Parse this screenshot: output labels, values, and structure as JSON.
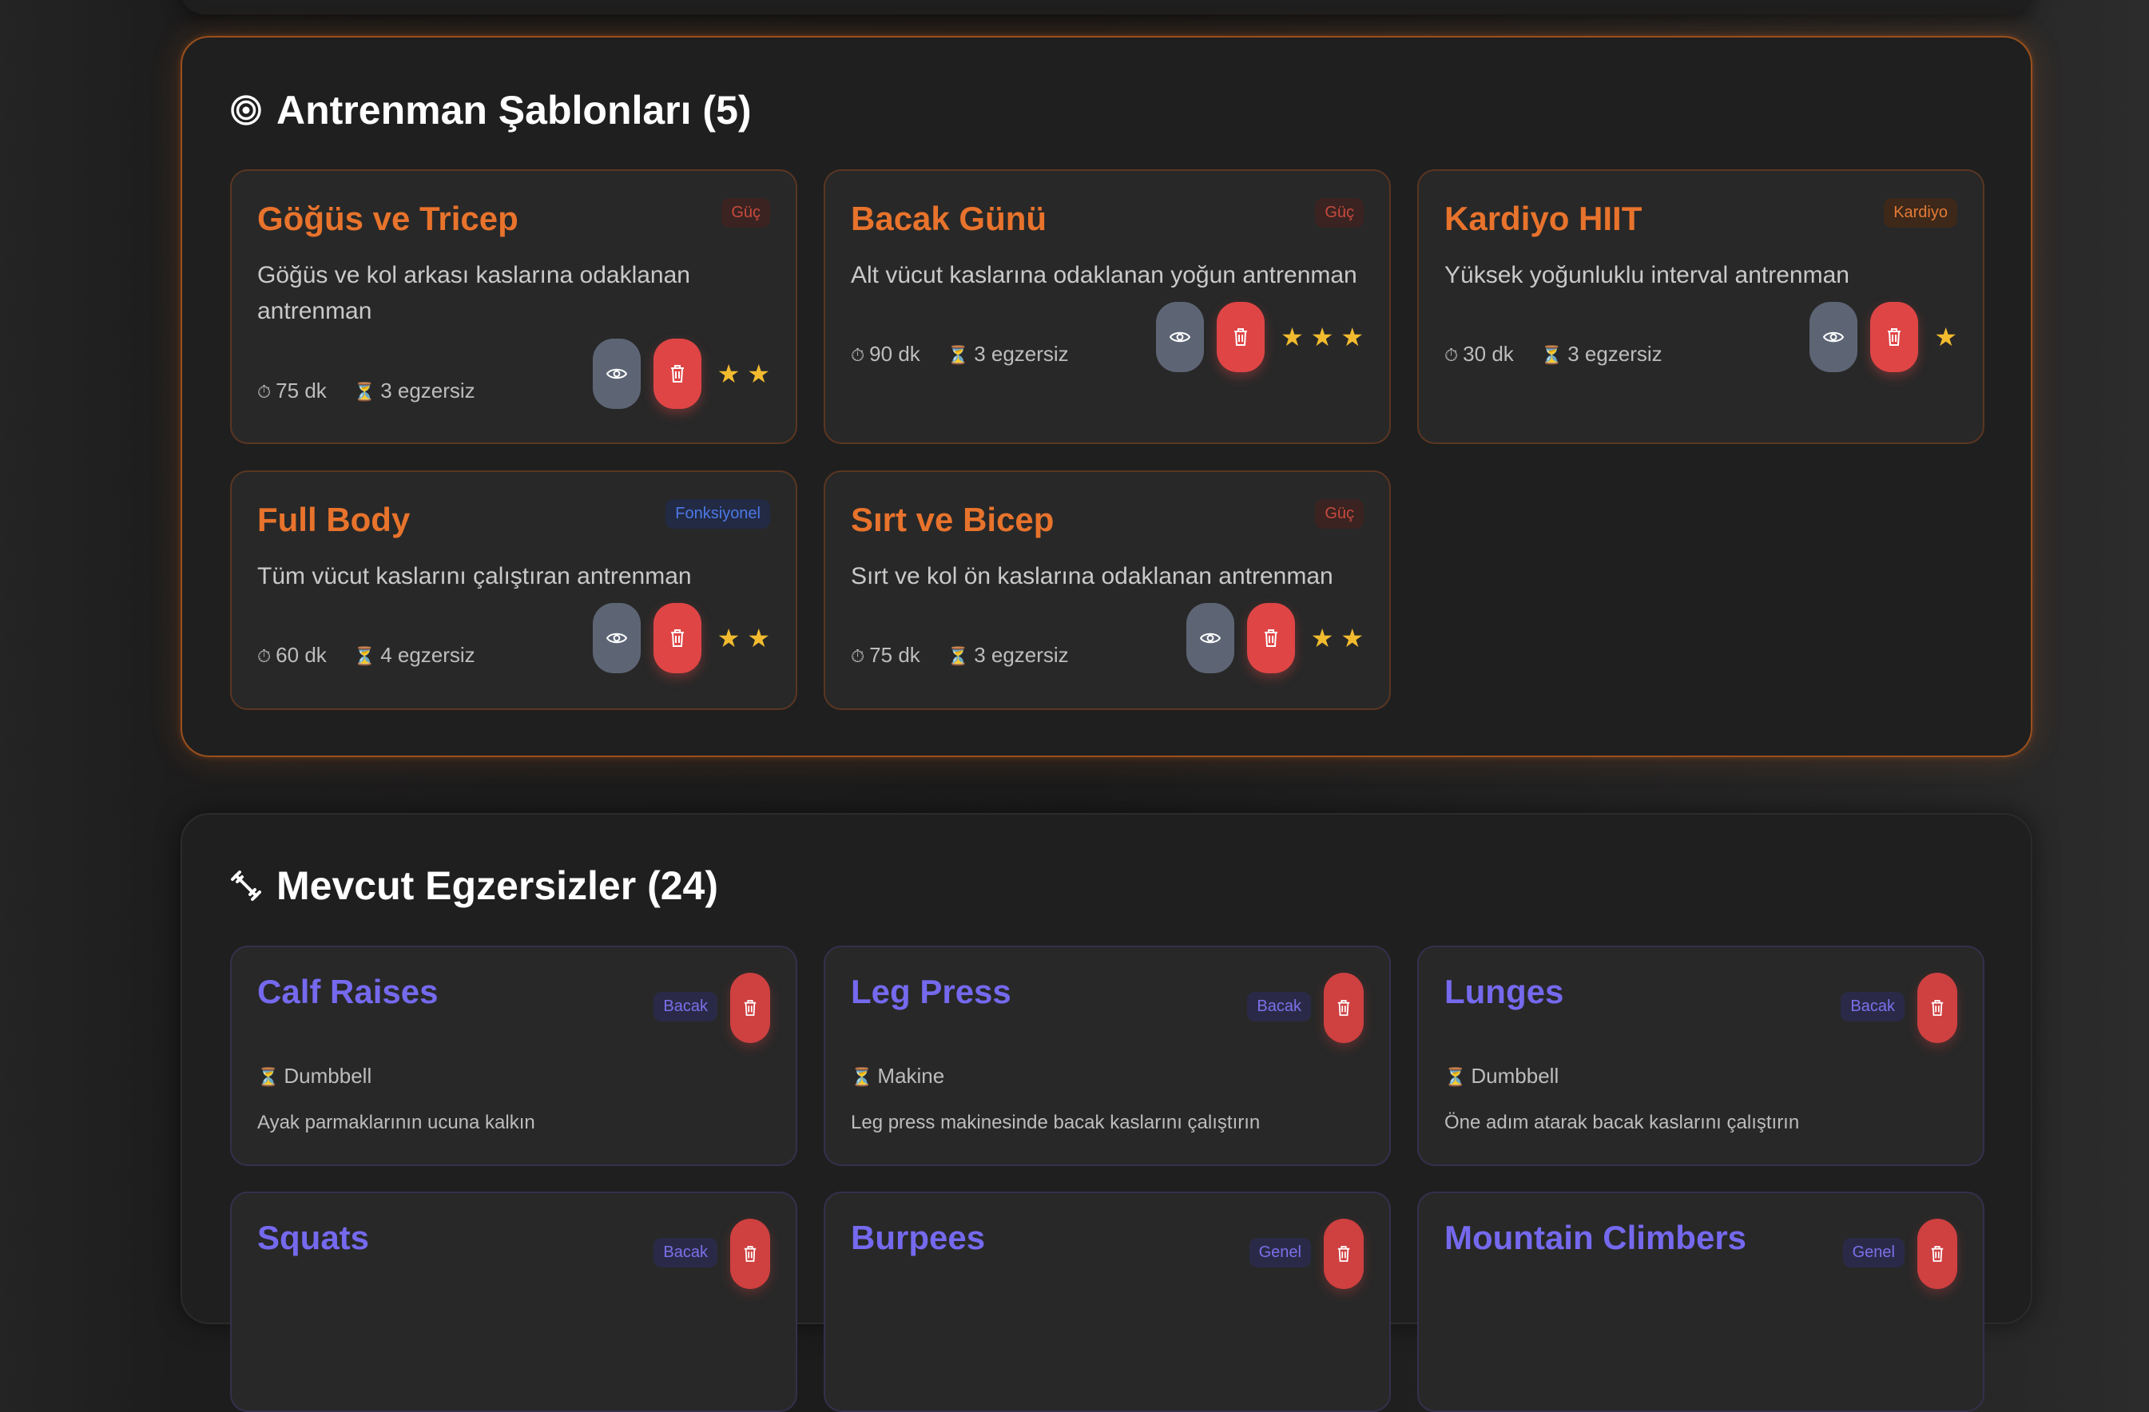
{
  "templates": {
    "title": "Antrenman Şablonları (5)",
    "title_icon": "target-icon",
    "items": [
      {
        "name": "Göğüs ve Tricep",
        "category": "Güç",
        "description": "Göğüs ve kol arkası kaslarına odaklanan antrenman",
        "duration": "75 dk",
        "exercises": "3 egzersiz",
        "stars": "★ ★"
      },
      {
        "name": "Bacak Günü",
        "category": "Güç",
        "description": "Alt vücut kaslarına odaklanan yoğun antrenman",
        "duration": "90 dk",
        "exercises": "3 egzersiz",
        "stars": "★ ★ ★"
      },
      {
        "name": "Kardiyo HIIT",
        "category": "Kardiyo",
        "description": "Yüksek yoğunluklu interval antrenman",
        "duration": "30 dk",
        "exercises": "3 egzersiz",
        "stars": "★"
      },
      {
        "name": "Full Body",
        "category": "Fonksiyonel",
        "description": "Tüm vücut kaslarını çalıştıran antrenman",
        "duration": "60 dk",
        "exercises": "4 egzersiz",
        "stars": "★ ★"
      },
      {
        "name": "Sırt ve Bicep",
        "category": "Güç",
        "description": "Sırt ve kol ön kaslarına odaklanan antrenman",
        "duration": "75 dk",
        "exercises": "3 egzersiz",
        "stars": "★ ★"
      }
    ]
  },
  "exercises": {
    "title": "Mevcut Egzersizler (24)",
    "title_icon": "dumbbell-icon",
    "items": [
      {
        "name": "Calf Raises",
        "category": "Bacak",
        "equipment": "Dumbbell",
        "description": "Ayak parmaklarının ucuna kalkın"
      },
      {
        "name": "Leg Press",
        "category": "Bacak",
        "equipment": "Makine",
        "description": "Leg press makinesinde bacak kaslarını çalıştırın"
      },
      {
        "name": "Lunges",
        "category": "Bacak",
        "equipment": "Dumbbell",
        "description": "Öne adım atarak bacak kaslarını çalıştırın"
      },
      {
        "name": "Squats",
        "category": "Bacak"
      },
      {
        "name": "Burpees",
        "category": "Genel"
      },
      {
        "name": "Mountain Climbers",
        "category": "Genel"
      }
    ]
  },
  "icons": {
    "timer": "stopwatch-icon",
    "exercise_count": "dumbbell-small-icon",
    "view": "eye-icon",
    "delete": "trash-icon",
    "rating": "star-icon"
  },
  "colors": {
    "accent_orange": "#e8732c",
    "accent_purple": "#7569ee",
    "delete_red": "#df4545",
    "star_yellow": "#f2bb2f"
  }
}
